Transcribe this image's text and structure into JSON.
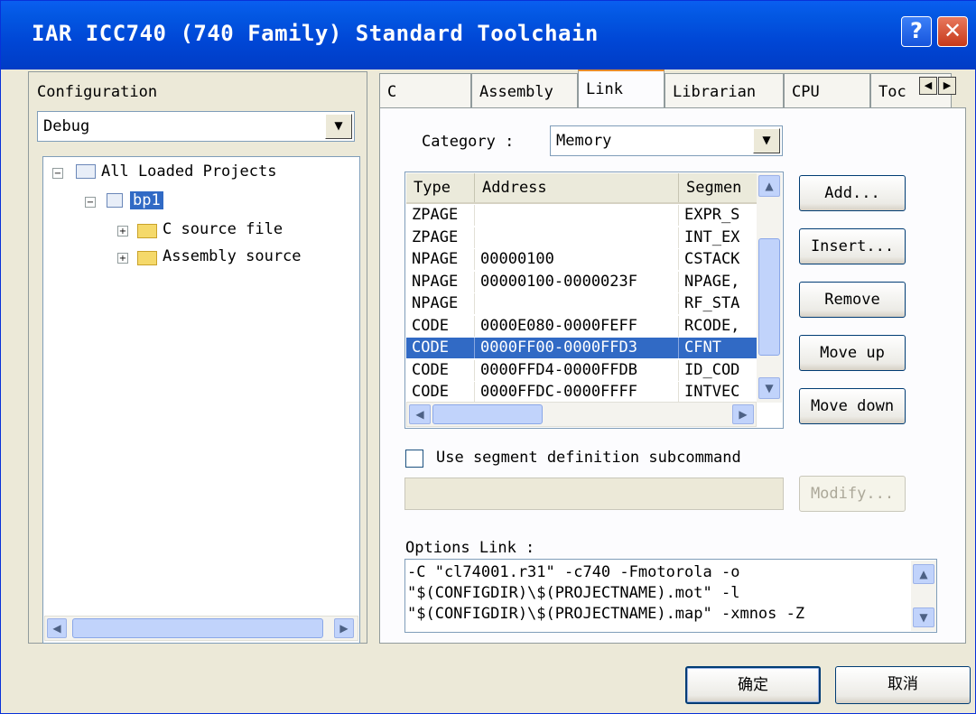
{
  "window": {
    "title": "IAR ICC740 (740 Family) Standard Toolchain",
    "help_glyph": "?",
    "close_glyph": "✕"
  },
  "left": {
    "configuration_label": "Configuration",
    "configuration_value": "Debug",
    "tree": {
      "root": "All Loaded Projects",
      "project": "bp1",
      "children": [
        "C source file",
        "Assembly source"
      ]
    }
  },
  "tabs": [
    "C",
    "Assembly",
    "Link",
    "Librarian",
    "CPU",
    "Toc"
  ],
  "active_tab": "Link",
  "link": {
    "category_label": "Category :",
    "category_value": "Memory",
    "columns": [
      "Type",
      "Address",
      "Segmen"
    ],
    "rows": [
      [
        "ZPAGE",
        "",
        "EXPR_S"
      ],
      [
        "ZPAGE",
        "",
        "INT_EX"
      ],
      [
        "NPAGE",
        "00000100",
        "CSTACK"
      ],
      [
        "NPAGE",
        "00000100-0000023F",
        "NPAGE,"
      ],
      [
        "NPAGE",
        "",
        "RF_STA"
      ],
      [
        "CODE",
        "0000E080-0000FEFF",
        "RCODE,"
      ],
      [
        "CODE",
        "0000FF00-0000FFD3",
        "CFNT"
      ],
      [
        "CODE",
        "0000FFD4-0000FFDB",
        "ID_COD"
      ],
      [
        "CODE",
        "0000FFDC-0000FFFF",
        "INTVEC"
      ]
    ],
    "selected_row": 6,
    "buttons": {
      "add": "Add...",
      "insert": "Insert...",
      "remove": "Remove",
      "move_up": "Move up",
      "move_down": "Move down"
    },
    "use_segment_label": "Use segment definition subcommand",
    "modify_label": "Modify...",
    "options_label": "Options Link :",
    "options_lines": [
      "-C \"cl74001.r31\" -c740 -Fmotorola -o",
      "\"$(CONFIGDIR)\\$(PROJECTNAME).mot\" -l",
      "\"$(CONFIGDIR)\\$(PROJECTNAME).map\" -xmnos -Z"
    ]
  },
  "footer": {
    "ok": "确定",
    "cancel": "取消"
  }
}
